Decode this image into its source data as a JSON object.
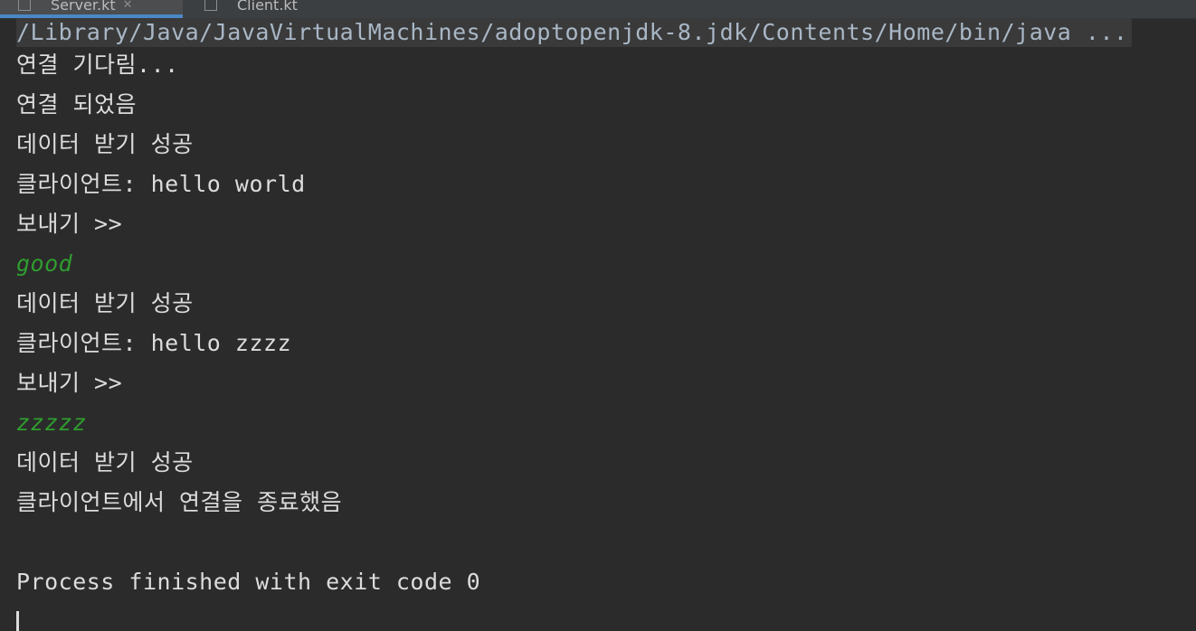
{
  "tabs": [
    {
      "label": "Server.kt",
      "active": true
    },
    {
      "label": "Client.kt",
      "active": false
    }
  ],
  "console": {
    "command": "/Library/Java/JavaVirtualMachines/adoptopenjdk-8.jdk/Contents/Home/bin/java ...",
    "lines": [
      {
        "text": "연결 기다림...",
        "type": "output"
      },
      {
        "text": "연결 되었음",
        "type": "output"
      },
      {
        "text": "데이터 받기 성공",
        "type": "output"
      },
      {
        "text": "클라이언트: hello world",
        "type": "output"
      },
      {
        "text": "보내기 >>",
        "type": "output"
      },
      {
        "text": "good",
        "type": "input"
      },
      {
        "text": "데이터 받기 성공",
        "type": "output"
      },
      {
        "text": "클라이언트: hello zzzz",
        "type": "output"
      },
      {
        "text": "보내기 >>",
        "type": "output"
      },
      {
        "text": "zzzzz",
        "type": "input"
      },
      {
        "text": "데이터 받기 성공",
        "type": "output"
      },
      {
        "text": "클라이언트에서 연결을 종료했음",
        "type": "output"
      },
      {
        "text": "",
        "type": "blank"
      },
      {
        "text": "Process finished with exit code 0",
        "type": "output"
      }
    ]
  },
  "colors": {
    "background": "#2b2b2b",
    "output_text": "#dcdcdc",
    "input_text": "#2f9e2f",
    "active_tab_underline": "#4a88c7"
  }
}
